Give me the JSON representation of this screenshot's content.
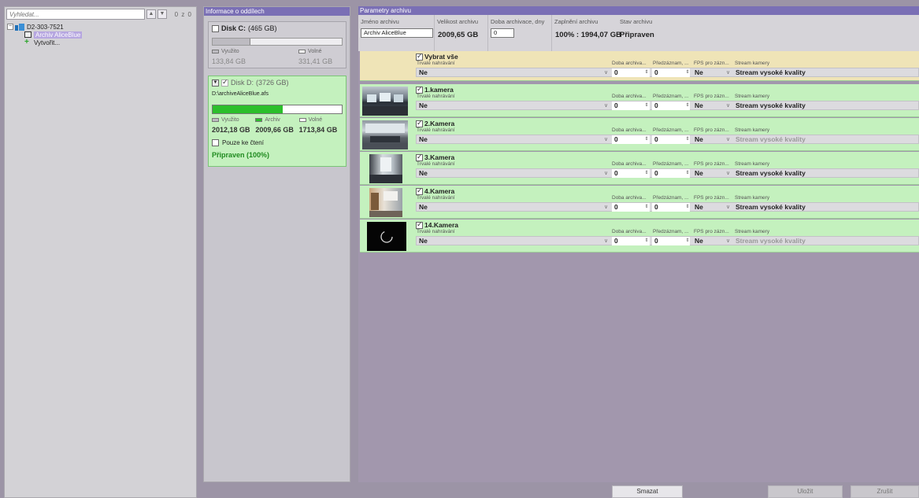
{
  "tree": {
    "search_placeholder": "Vyhledat...",
    "up_icon": "chevron-up-icon",
    "down_icon": "chevron-down-icon",
    "match_count": "0 z 0",
    "server_label": "D2-303-7521",
    "archive_label": "Archiv AliceBlue",
    "create_label": "Vytvořit..."
  },
  "disk_panel": {
    "header": "Informace o oddílech",
    "disk_c": {
      "name": "Disk C:",
      "size": "(465 GB)",
      "used_label": "Využito",
      "free_label": "Volné",
      "used_value": "133,84 GB",
      "free_value": "331,41 GB",
      "used_fraction": 0.29
    },
    "disk_d": {
      "name": "Disk D:",
      "size": "(3726 GB)",
      "path": "D:\\archiveAliceBlue.afs",
      "used_label": "Využito",
      "archive_label": "Archiv",
      "free_label": "Volné",
      "used_value": "2012,18 GB",
      "archive_value": "2009,66 GB",
      "free_value": "1713,84 GB",
      "archive_fraction": 0.54,
      "readonly_label": "Pouze ke čtení",
      "status": "Připraven (100%)"
    }
  },
  "archive": {
    "header": "Parametry archivu",
    "name_label": "Jméno archivu",
    "name_value": "Archiv AliceBlue",
    "size_label": "Velikost archivu",
    "size_value": "2009,65 GB",
    "duration_label": "Doba archivace, dny",
    "duration_value": "0",
    "fill_label": "Zaplnění archivu",
    "fill_value": "100% : 1994,07 GB",
    "state_label": "Stav archivu",
    "state_value": "Připraven"
  },
  "columns": {
    "permanent": "Trvalé nahrávání",
    "duration": "Doba archiva...",
    "prerecord": "Předzáznam, ...",
    "fps": "FPS pro zázn...",
    "stream": "Stream kamery"
  },
  "select_all": {
    "label": "Vybrat vše",
    "permanent": "Ne",
    "duration": "0",
    "prerecord": "0",
    "fps": "Ne",
    "stream": "Stream vysoké kvality"
  },
  "cameras": [
    {
      "name": "1.kamera",
      "permanent": "Ne",
      "duration": "0",
      "prerecord": "0",
      "fps": "Ne",
      "stream": "Stream vysoké kvality"
    },
    {
      "name": "2.Kamera",
      "permanent": "Ne",
      "duration": "0",
      "prerecord": "0",
      "fps": "Ne",
      "stream": "Stream vysoké kvality"
    },
    {
      "name": "3.Kamera",
      "permanent": "Ne",
      "duration": "0",
      "prerecord": "0",
      "fps": "Ne",
      "stream": "Stream vysoké kvality"
    },
    {
      "name": "4.Kamera",
      "permanent": "Ne",
      "duration": "0",
      "prerecord": "0",
      "fps": "Ne",
      "stream": "Stream vysoké kvality"
    },
    {
      "name": "14.Kamera",
      "permanent": "Ne",
      "duration": "0",
      "prerecord": "0",
      "fps": "Ne",
      "stream": "Stream vysoké kvality"
    }
  ],
  "buttons": {
    "delete": "Smazat",
    "save": "Uložit",
    "cancel": "Zrušit"
  },
  "colors": {
    "header_purple": "#7a6fb5",
    "camera_row_green": "#c4f1be",
    "select_all_yellow": "#efe4b7",
    "archive_bar_green": "#2bbf2b"
  }
}
